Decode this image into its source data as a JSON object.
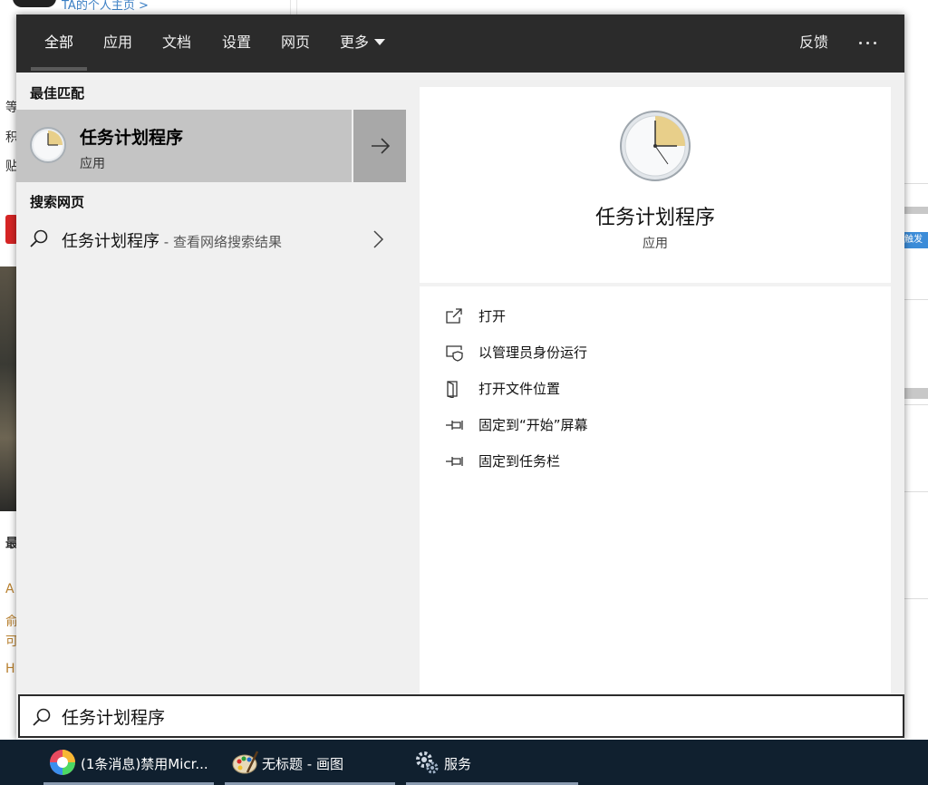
{
  "background_page": {
    "top_link": "TA的个人主页 >",
    "left_chars": [
      "等",
      "积",
      "贴",
      "最",
      "A",
      "俞",
      "可",
      "H"
    ],
    "right_tag": "触发"
  },
  "tabs": [
    {
      "label": "全部",
      "active": true
    },
    {
      "label": "应用",
      "active": false
    },
    {
      "label": "文档",
      "active": false
    },
    {
      "label": "设置",
      "active": false
    },
    {
      "label": "网页",
      "active": false
    },
    {
      "label": "更多",
      "active": false
    }
  ],
  "topbar": {
    "feedback": "反馈",
    "more_icon": "ellipsis-icon"
  },
  "best_match": {
    "section_title": "最佳匹配",
    "name": "任务计划程序",
    "type": "应用",
    "icon": "clock-icon"
  },
  "web_search": {
    "section_title": "搜索网页",
    "query": "任务计划程序",
    "hint": " - 查看网络搜索结果"
  },
  "detail": {
    "name": "任务计划程序",
    "type": "应用",
    "actions": [
      {
        "label": "打开",
        "icon": "open-icon"
      },
      {
        "label": "以管理员身份运行",
        "icon": "run-as-admin-icon"
      },
      {
        "label": "打开文件位置",
        "icon": "file-location-icon"
      },
      {
        "label": "固定到“开始”屏幕",
        "icon": "pin-icon"
      },
      {
        "label": "固定到任务栏",
        "icon": "pin-icon"
      }
    ]
  },
  "search": {
    "value": "任务计划程序"
  },
  "taskbar": [
    {
      "label": "(1条消息)禁用Micr...",
      "icon": "browser-icon"
    },
    {
      "label": "无标题 - 画图",
      "icon": "paint-icon"
    },
    {
      "label": "服务",
      "icon": "services-gear-icon"
    }
  ],
  "colors": {
    "topbar": "#2b2b2b",
    "pane": "#f0f0f0",
    "selected": "#c4c4c4",
    "taskbar": "#10202f"
  }
}
